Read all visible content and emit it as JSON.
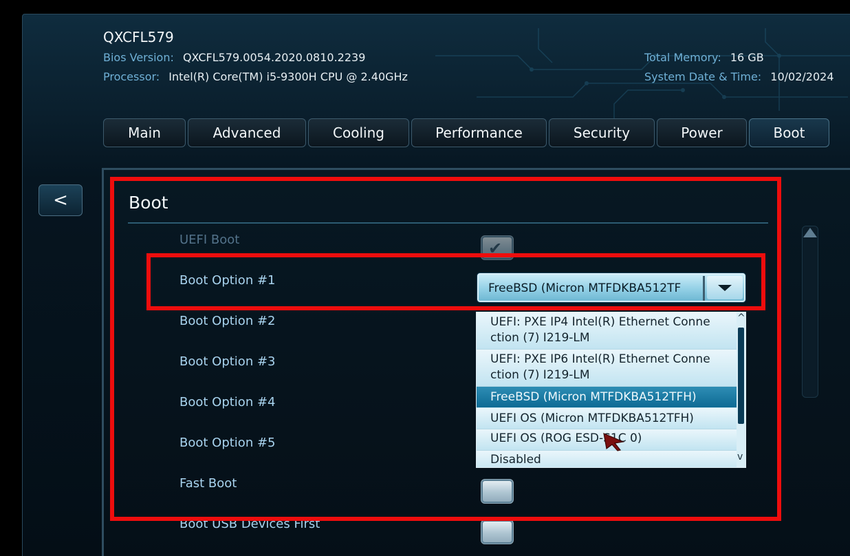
{
  "header": {
    "model": "QXCFL579",
    "bios_version_label": "Bios Version:",
    "bios_version": "QXCFL579.0054.2020.0810.2239",
    "processor_label": "Processor:",
    "processor": "Intel(R) Core(TM) i5-9300H CPU @ 2.40GHz",
    "total_memory_label": "Total Memory:",
    "total_memory": "16 GB",
    "datetime_label": "System Date & Time:",
    "datetime": "10/02/2024"
  },
  "tabs": [
    {
      "label": "Main"
    },
    {
      "label": "Advanced"
    },
    {
      "label": "Cooling"
    },
    {
      "label": "Performance"
    },
    {
      "label": "Security"
    },
    {
      "label": "Power"
    },
    {
      "label": "Boot",
      "active": true
    }
  ],
  "back_button": "<",
  "panel": {
    "title": "Boot",
    "options": [
      {
        "label": "UEFI Boot",
        "control": "checkbox",
        "checked": true,
        "disabled": true
      },
      {
        "label": "Boot Option #1",
        "control": "select",
        "value": "FreeBSD (Micron MTFDKBA512TF"
      },
      {
        "label": "Boot Option #2"
      },
      {
        "label": "Boot Option #3"
      },
      {
        "label": "Boot Option #4"
      },
      {
        "label": "Boot Option #5"
      },
      {
        "label": "Fast Boot",
        "control": "checkbox",
        "checked": false
      },
      {
        "label": "Boot USB Devices First",
        "control": "checkbox",
        "checked": false
      }
    ]
  },
  "dropdown": {
    "items": [
      {
        "line1": "UEFI: PXE IP4 Intel(R) Ethernet Conne",
        "line2": "ction (7) I219-LM"
      },
      {
        "line1": "UEFI: PXE IP6 Intel(R) Ethernet Conne",
        "line2": "ction (7) I219-LM"
      },
      {
        "line1": "FreeBSD (Micron MTFDKBA512TFH)",
        "selected": true
      },
      {
        "line1": "UEFI OS (Micron MTFDKBA512TFH)"
      },
      {
        "line1": "UEFI OS (ROG ESD-S1C 0)"
      },
      {
        "line1": "Disabled"
      }
    ],
    "scroll_up": "^",
    "scroll_down": "v"
  },
  "icons": {
    "checkmark": "check-icon",
    "dropdown_arrow": "chevron-down-icon",
    "pointer": "mouse-pointer-icon",
    "scroll_up": "scroll-up-icon"
  },
  "colors": {
    "highlight_box": "#ee0d0d",
    "selected_item": "#0d6a94",
    "label_text": "#a8d3ee"
  }
}
